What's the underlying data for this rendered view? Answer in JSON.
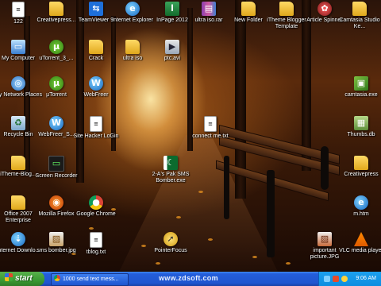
{
  "desktop": {
    "icons": [
      {
        "label": "122",
        "icon": "doc-icon"
      },
      {
        "label": "Creativepress...",
        "icon": "folder-icon"
      },
      {
        "label": "TeamViewer 9",
        "icon": "teamviewer-icon"
      },
      {
        "label": "Internet Explorer",
        "icon": "internet-explorer-icon"
      },
      {
        "label": "InPage 2012",
        "icon": "inpage-icon"
      },
      {
        "label": "ultra iso.rar",
        "icon": "rar-archive-icon"
      },
      {
        "label": "New Folder",
        "icon": "folder-icon"
      },
      {
        "label": "iTheme Blogger Template",
        "icon": "folder-icon"
      },
      {
        "label": "Article Spinner",
        "icon": "article-spinner-icon"
      },
      {
        "label": "Camtasia Studio Ke...",
        "icon": "folder-icon"
      },
      {
        "label": "My Computer",
        "icon": "my-computer-icon"
      },
      {
        "label": "uTorrent_3_...",
        "icon": "utorrent-icon"
      },
      {
        "label": "Crack",
        "icon": "folder-icon"
      },
      {
        "label": "ultra iso",
        "icon": "folder-icon"
      },
      {
        "label": "ptc.avi",
        "icon": "video-file-icon"
      },
      {
        "label": "My Network Places",
        "icon": "network-places-icon"
      },
      {
        "label": "µTorrent",
        "icon": "utorrent-icon"
      },
      {
        "label": "WebFreer",
        "icon": "webfreer-icon"
      },
      {
        "label": "camtasia.exe",
        "icon": "camtasia-exe-icon"
      },
      {
        "label": "Recycle Bin",
        "icon": "recycle-bin-icon"
      },
      {
        "label": "WebFreer_S...",
        "icon": "webfreer-setup-icon"
      },
      {
        "label": "Site Hacker LoGin",
        "icon": "doc-icon"
      },
      {
        "label": "connect me.txt",
        "icon": "text-file-icon"
      },
      {
        "label": "Thumbs.db",
        "icon": "thumbs-db-icon"
      },
      {
        "label": "iTheme-Blog...",
        "icon": "folder-icon"
      },
      {
        "label": "Screen Recorder",
        "icon": "screen-recorder-icon"
      },
      {
        "label": "2-A's Pak SMS Bomber.exe",
        "icon": "pakistan-flag-icon"
      },
      {
        "label": "Creativepress",
        "icon": "folder-icon"
      },
      {
        "label": "Office 2007 Enterprise",
        "icon": "folder-icon"
      },
      {
        "label": "Mozilla Firefox",
        "icon": "firefox-icon"
      },
      {
        "label": "Google Chrome",
        "icon": "chrome-icon"
      },
      {
        "label": "m.htm",
        "icon": "html-file-icon"
      },
      {
        "label": "Internet Downlo...",
        "icon": "internet-download-manager-icon"
      },
      {
        "label": "sms bomber.jpg",
        "icon": "image-file-icon"
      },
      {
        "label": "tblog.txt",
        "icon": "text-file-icon"
      },
      {
        "label": "PointerFocus",
        "icon": "pointerfocus-icon"
      },
      {
        "label": "important picture.JPG",
        "icon": "image-file-icon"
      },
      {
        "label": "VLC media player",
        "icon": "vlc-icon"
      }
    ]
  },
  "taskbar": {
    "start_label": "start",
    "task_button_label": "1000 send text mess...",
    "watermark": "www.zdsoft.com",
    "clock": "9:06 AM"
  },
  "colors": {
    "taskbar_blue": "#245edb",
    "start_green": "#3a9a33",
    "tray_blue": "#0d8de0"
  }
}
